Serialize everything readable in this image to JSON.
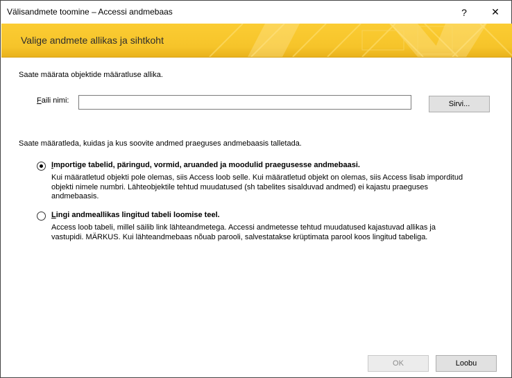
{
  "window": {
    "title": "Välisandmete toomine – Accessi andmebaas",
    "help_icon": "?",
    "close_icon": "✕"
  },
  "banner": {
    "title": "Valige andmete allikas ja sihtkoht"
  },
  "source": {
    "intro": "Saate määrata objektide määratluse allika.",
    "file_label_first": "F",
    "file_label_rest": "aili nimi:",
    "file_value": "",
    "browse_button": "Sirvi..."
  },
  "storage": {
    "intro": "Saate määratleda, kuidas ja kus soovite andmed praeguses andmebaasis talletada.",
    "options": [
      {
        "checked": true,
        "title_first": "I",
        "title_rest": "mportige tabelid, päringud, vormid, aruanded ja moodulid praegusesse andmebaasi.",
        "lines": [
          "Kui määratletud objekti pole olemas, siis Access loob selle. Kui määratletud objekt on olemas, siis Access lisab imporditud",
          "objekti nimele numbri. Lähteobjektile tehtud muudatused (sh tabelites sisalduvad andmed) ei kajastu praeguses",
          "andmebaasis."
        ]
      },
      {
        "checked": false,
        "title_first": "L",
        "title_rest": "ingi andmeallikas lingitud tabeli loomise teel.",
        "lines": [
          "Access loob tabeli, millel säilib link lähteandmetega. Accessi andmetesse tehtud muudatused kajastuvad allikas ja",
          "vastupidi. MÄRKUS. Kui lähteandmebaas nõuab parooli, salvestatakse krüptimata parool koos lingitud tabeliga."
        ]
      }
    ]
  },
  "footer": {
    "ok_button": "OK",
    "cancel_button": "Loobu"
  }
}
